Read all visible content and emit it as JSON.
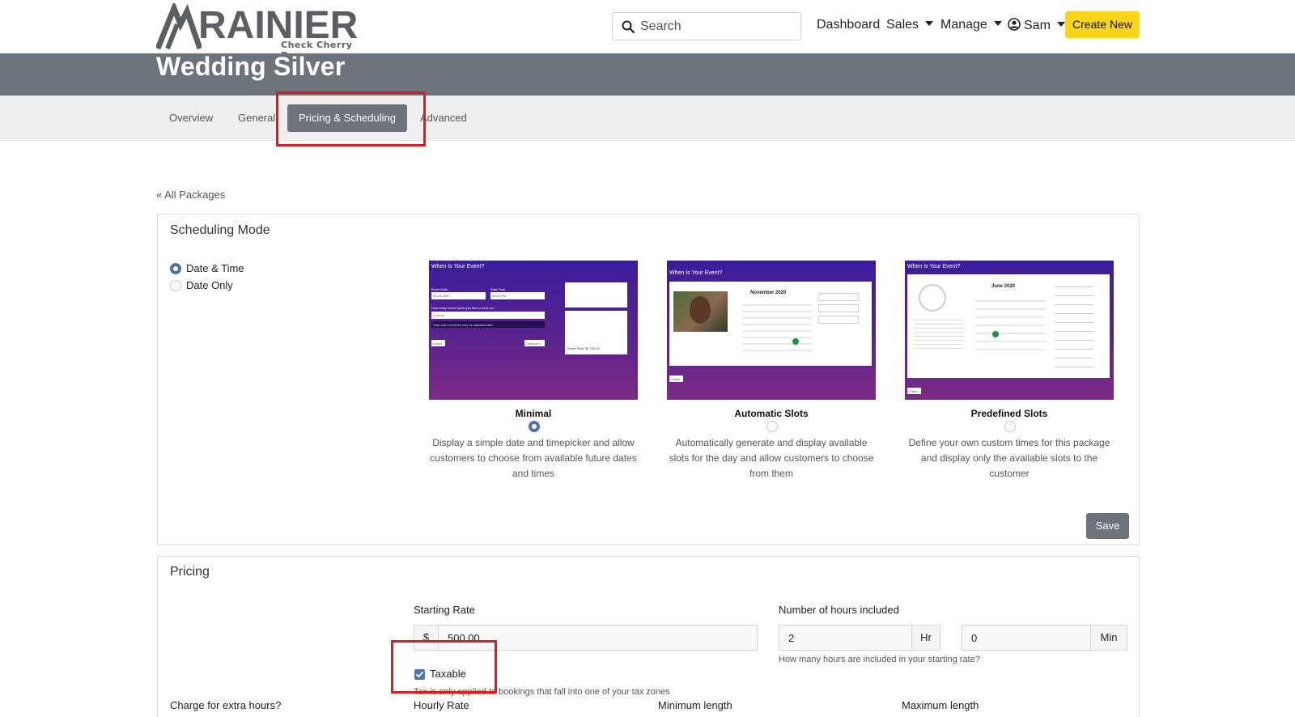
{
  "brand": {
    "name": "RAINIER",
    "subtitle": "Check Cherry Demo"
  },
  "search": {
    "placeholder": "Search"
  },
  "nav": {
    "dashboard": "Dashboard",
    "sales": "Sales",
    "manage": "Manage",
    "user": "Sam",
    "create_new": "Create New"
  },
  "page": {
    "title": "Wedding Silver",
    "back_link": "« All Packages"
  },
  "tabs": [
    "Overview",
    "General",
    "Pricing & Scheduling",
    "Advanced"
  ],
  "active_tab": "Pricing & Scheduling",
  "scheduling": {
    "title": "Scheduling Mode",
    "modes": [
      {
        "label": "Date & Time",
        "selected": true
      },
      {
        "label": "Date Only",
        "selected": false
      }
    ],
    "options": [
      {
        "title": "Minimal",
        "selected": true,
        "description": "Display a simple date and timepicker and allow customers to choose from available future dates and times"
      },
      {
        "title": "Automatic Slots",
        "selected": false,
        "description": "Automatically generate and display available slots for the day and allow customers to choose from them"
      },
      {
        "title": "Predefined Slots",
        "selected": false,
        "description": "Define your own custom times for this package and display only the available slots to the customer"
      }
    ],
    "previews": {
      "minimal": {
        "heading": "When Is Your Event?",
        "event_date_label": "Event Date",
        "start_time_label": "Start Time",
        "event_date": "06-29-2020",
        "start_time": "05:00 PM",
        "hours_question": "How many hours would you like to book us?",
        "hours_value": "2 Hours",
        "note": "Start and end times may be adjusted later",
        "back": "« Back",
        "continue": "Continue »",
        "event_total": "Event Total: $2,700.00"
      },
      "automatic": {
        "heading": "When Is Your Event?",
        "month": "November 2020",
        "back": "« Back"
      },
      "predefined": {
        "heading": "When Is Your Event?",
        "month": "June 2020",
        "back": "« Back"
      }
    },
    "save_label": "Save"
  },
  "pricing": {
    "title": "Pricing",
    "starting_rate_label": "Starting Rate",
    "currency": "$",
    "starting_rate": "500.00",
    "hours_label": "Number of hours included",
    "hours_value": "2",
    "hours_unit": "Hr",
    "minutes_value": "0",
    "minutes_unit": "Min",
    "hours_help": "How many hours are included in your starting rate?",
    "taxable_label": "Taxable",
    "taxable": true,
    "tax_help": "Tax is only applied to bookings that fall into one of your tax zones",
    "extra_hours_label": "Charge for extra hours?",
    "hourly_rate_label": "Hourly Rate",
    "min_length_label": "Minimum length",
    "max_length_label": "Maximum length"
  },
  "colors": {
    "accent": "#fbd51a",
    "header": "#6c737b",
    "highlight": "#e0191c",
    "radio": "#4f73a8"
  }
}
